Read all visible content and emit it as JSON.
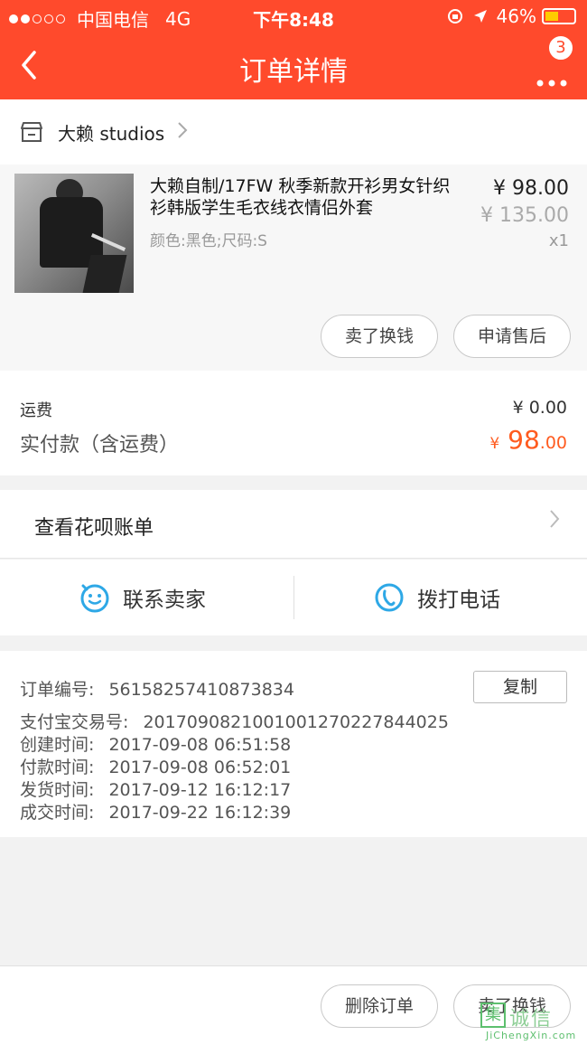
{
  "status_bar": {
    "carrier": "中国电信",
    "network": "4G",
    "time": "下午8:48",
    "battery": "46%"
  },
  "nav": {
    "title": "订单详情",
    "back_icon": "chevron-left-icon",
    "more_icon": "more-dots-icon",
    "badge_count": "3"
  },
  "shop": {
    "name": "大赖 studios",
    "icon": "store-icon"
  },
  "item": {
    "title": "大赖自制/17FW 秋季新款开衫男女针织衫韩版学生毛衣线衣情侣外套",
    "spec": "颜色:黑色;尺码:S",
    "price": "¥ 98.00",
    "original_price": "¥ 135.00",
    "quantity": "x1",
    "button_resell": "卖了换钱",
    "button_aftersale": "申请售后"
  },
  "cost": {
    "shipping_label": "运费",
    "shipping_value": "¥ 0.00",
    "paid_label": "实付款（含运费）",
    "paid_currency": "¥",
    "paid_integer": " 98",
    "paid_decimal": ".00"
  },
  "huabei": {
    "label": "查看花呗账单"
  },
  "contact": {
    "seller_label": "联系卖家",
    "call_label": "拨打电话"
  },
  "order_info": {
    "order_no_label": "订单编号:",
    "order_no": "56158257410873834",
    "copy_label": "复制",
    "alipay_no_label": "支付宝交易号:",
    "alipay_no": "2017090821001001270227844025",
    "created_label": "创建时间:",
    "created": "2017-09-08 06:51:58",
    "paid_label": "付款时间:",
    "paid": "2017-09-08 06:52:01",
    "shipped_label": "发货时间:",
    "shipped": "2017-09-12 16:12:17",
    "completed_label": "成交时间:",
    "completed": "2017-09-22 16:12:39"
  },
  "bottom": {
    "delete_label": "删除订单",
    "resell_label": "卖了换钱",
    "watermark_char": "集",
    "watermark_text": "诚信",
    "watermark_sub": "JiChengXin.com"
  },
  "colors": {
    "brand": "#ff4a2c",
    "price_accent": "#ff5b1f",
    "icon_blue": "#2ea8e6"
  }
}
